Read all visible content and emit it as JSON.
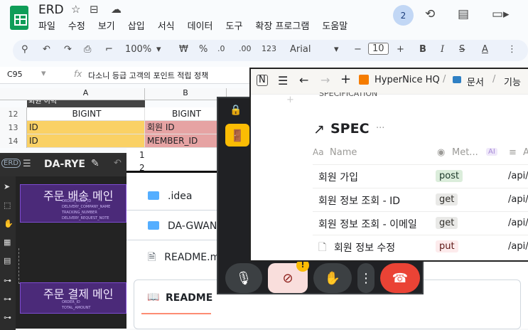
{
  "sheets": {
    "title": "ERD",
    "menu": [
      "파일",
      "수정",
      "보기",
      "삽입",
      "서식",
      "데이터",
      "도구",
      "확장 프로그램",
      "도움말"
    ],
    "avatar": "2",
    "zoom": "100%",
    "currency": "₩",
    "percent": "%",
    "dec1": ".0",
    "dec2": ".00",
    "num_fmt": "123",
    "font": "Arial",
    "font_size": "10",
    "cell_ref": "C95",
    "formula": "다소니 등급 고객의 포인트 적립 정책",
    "col_a": "A",
    "col_b": "B",
    "rows": [
      {
        "n": "12",
        "a": "BIGINT",
        "b": "BIGINT"
      },
      {
        "n": "13",
        "a": "ID",
        "b": "회원 ID"
      },
      {
        "n": "14",
        "a": "ID",
        "b": "MEMBER_ID"
      }
    ],
    "row_partial": "회원 이력"
  },
  "erd": {
    "app": "ERD",
    "name": "DA-RYE",
    "table1": "주문 배송 메인",
    "table2": "주문 결제 메인",
    "t1_rows": [
      "ORDER_MAIN_ID",
      "DELIVERY_COMPANY_NAME",
      "TRACKING_NUMBER",
      "DELIVERY_REQUEST_NOTE"
    ],
    "t2_rows": [
      "ORDER_ID",
      "TOTAL_AMOUNT"
    ],
    "line_nums": [
      "1",
      "2"
    ]
  },
  "github": {
    "items": [
      ".idea",
      "DA-GWAN",
      "README.md"
    ],
    "readme_tab": "README"
  },
  "notion": {
    "breadcrumb": [
      "HyperNice HQ",
      "문서",
      "기능"
    ],
    "partial_header": "SPECIFICATION",
    "page_title": "SPEC",
    "col_name": "Name",
    "col_method": "Met...",
    "col_api": "A",
    "ai": "AI",
    "rows": [
      {
        "name": "회원 가입",
        "method": "post",
        "api": "/api/"
      },
      {
        "name": "회원 정보 조회 - ID",
        "method": "get",
        "api": "/api/"
      },
      {
        "name": "회원 정보 조회 - 이메일",
        "method": "get",
        "api": "/api/"
      },
      {
        "name": "회원 정보 수정",
        "method": "put",
        "api": "/api/"
      }
    ]
  },
  "colors": {
    "id_fill": "#fad165",
    "member_fill": "#e6a3a3",
    "erd_purple": "#4b2a79",
    "hangup": "#ea4335",
    "camera_off": "#f9dedc"
  }
}
